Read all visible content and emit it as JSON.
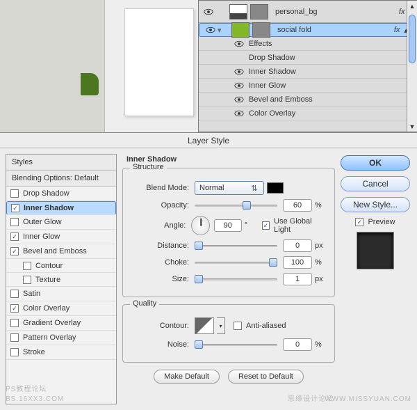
{
  "layers": {
    "row1": {
      "name": "personal_bg",
      "fx": "fx"
    },
    "row2": {
      "name": "social fold",
      "fx": "fx"
    },
    "effects_label": "Effects",
    "fx_items": [
      "Drop Shadow",
      "Inner Shadow",
      "Inner Glow",
      "Bevel and Emboss",
      "Color Overlay"
    ]
  },
  "dialog": {
    "title": "Layer Style",
    "styles_header": "Styles",
    "blend_header": "Blending Options: Default",
    "items": {
      "drop_shadow": "Drop Shadow",
      "inner_shadow": "Inner Shadow",
      "outer_glow": "Outer Glow",
      "inner_glow": "Inner Glow",
      "bevel": "Bevel and Emboss",
      "contour": "Contour",
      "texture": "Texture",
      "satin": "Satin",
      "color_overlay": "Color Overlay",
      "grad_overlay": "Gradient Overlay",
      "pat_overlay": "Pattern Overlay",
      "stroke": "Stroke"
    },
    "panel_title": "Inner Shadow",
    "structure": "Structure",
    "quality": "Quality",
    "blend_mode_label": "Blend Mode:",
    "blend_mode_value": "Normal",
    "opacity_label": "Opacity:",
    "opacity_value": "60",
    "pct": "%",
    "angle_label": "Angle:",
    "angle_value": "90",
    "deg": "°",
    "global": "Use Global Light",
    "distance_label": "Distance:",
    "distance_value": "0",
    "px": "px",
    "choke_label": "Choke:",
    "choke_value": "100",
    "size_label": "Size:",
    "size_value": "1",
    "contour_label": "Contour:",
    "anti": "Anti-aliased",
    "noise_label": "Noise:",
    "noise_value": "0",
    "make_default": "Make Default",
    "reset_default": "Reset to Default",
    "ok": "OK",
    "cancel": "Cancel",
    "new_style": "New Style...",
    "preview": "Preview"
  },
  "watermarks": {
    "a": "PS教程论坛",
    "b": "BS.16XX3.COM",
    "c": "思缘设计论坛",
    "d": "WWW.MISSYUAN.COM"
  }
}
